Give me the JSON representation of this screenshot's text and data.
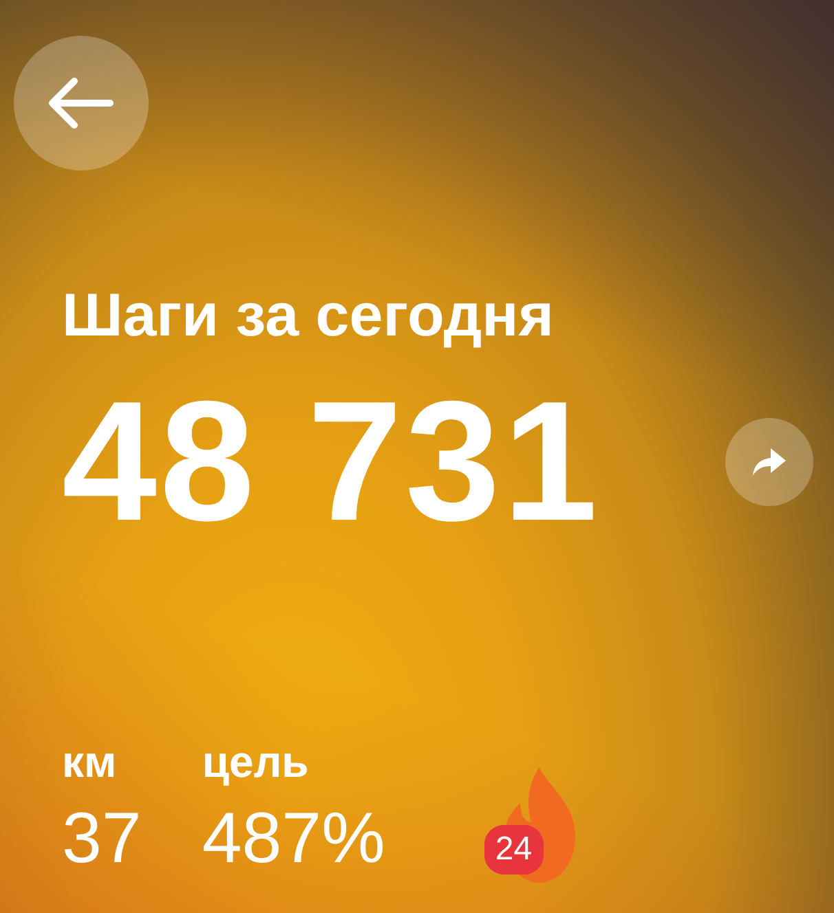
{
  "title": "Шаги за сегодня",
  "steps": "48 731",
  "stats": [
    {
      "label": "км",
      "value": "37"
    },
    {
      "label": "цель",
      "value": "487%"
    }
  ],
  "streak": {
    "count": "24"
  }
}
